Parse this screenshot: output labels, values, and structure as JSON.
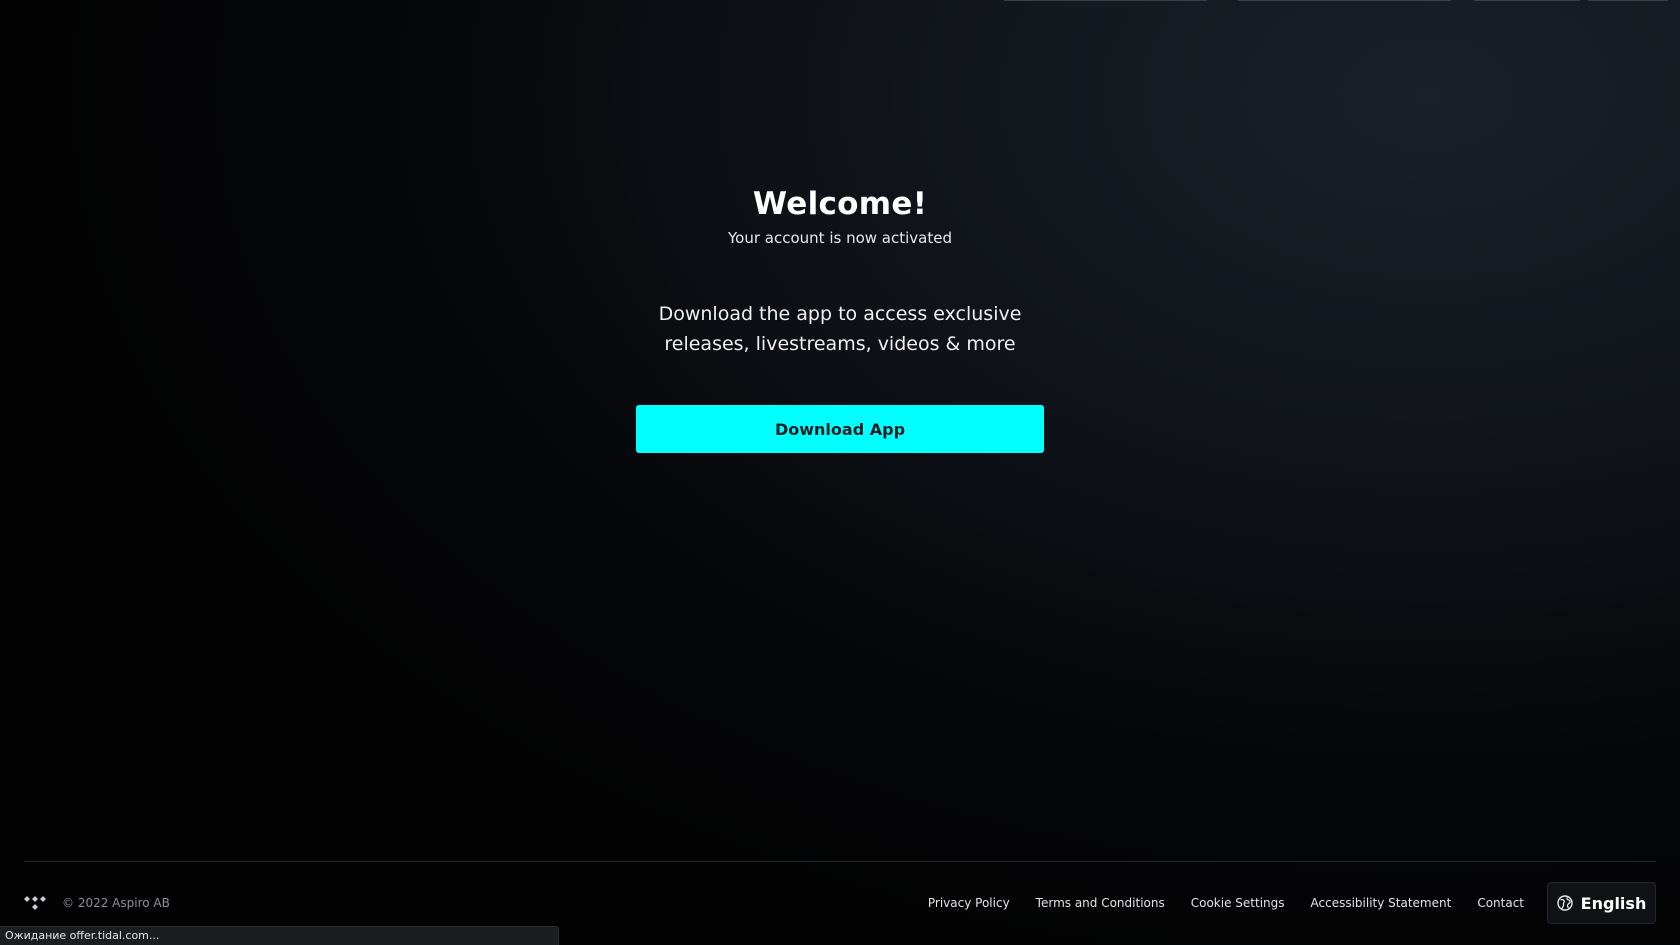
{
  "main": {
    "title": "Welcome!",
    "subtitle": "Your account is now activated",
    "promo_line1": "Download the app to access exclusive",
    "promo_line2": "releases, livestreams, videos & more",
    "download_button": "Download App"
  },
  "footer": {
    "copyright": "© 2022 Aspiro AB",
    "links": [
      "Privacy Policy",
      "Terms and Conditions",
      "Cookie Settings",
      "Accessibility Statement",
      "Contact"
    ],
    "language": "English"
  },
  "status_bar": {
    "text": "Ожидание offer.tidal.com..."
  },
  "colors": {
    "accent": "#00ffff",
    "background": "#0b0d11"
  },
  "icons": {
    "logo": "tidal-logo-icon",
    "language": "globe-icon"
  }
}
